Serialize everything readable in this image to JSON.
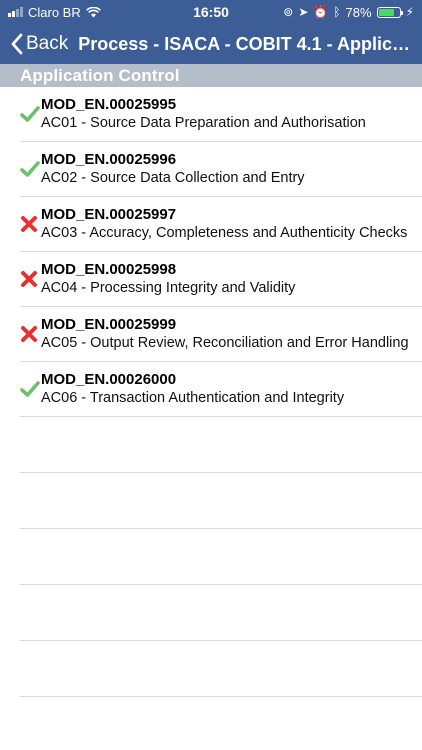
{
  "status": {
    "carrier": "Claro BR",
    "time": "16:50",
    "battery": "78%",
    "battery_level": 0.78
  },
  "nav": {
    "back_label": "Back",
    "title": "Process - ISACA - COBIT 4.1 - Applicat..."
  },
  "section": {
    "title": "Application Control"
  },
  "items": [
    {
      "id": "MOD_EN.00025995",
      "desc": "AC01 - Source Data Preparation and Authorisation",
      "status": "check"
    },
    {
      "id": "MOD_EN.00025996",
      "desc": "AC02 - Source Data Collection and Entry",
      "status": "check"
    },
    {
      "id": "MOD_EN.00025997",
      "desc": "AC03 - Accuracy, Completeness and Authenticity Checks",
      "status": "cross"
    },
    {
      "id": "MOD_EN.00025998",
      "desc": "AC04 - Processing Integrity and Validity",
      "status": "cross"
    },
    {
      "id": "MOD_EN.00025999",
      "desc": "AC05 - Output Review, Reconciliation and Error Handling",
      "status": "cross"
    },
    {
      "id": "MOD_EN.00026000",
      "desc": "AC06 - Transaction Authentication and Integrity",
      "status": "check"
    }
  ],
  "colors": {
    "nav": "#3d5d96",
    "section": "#b5bdc9",
    "check": "#6cbf6c",
    "cross": "#e8302e"
  }
}
